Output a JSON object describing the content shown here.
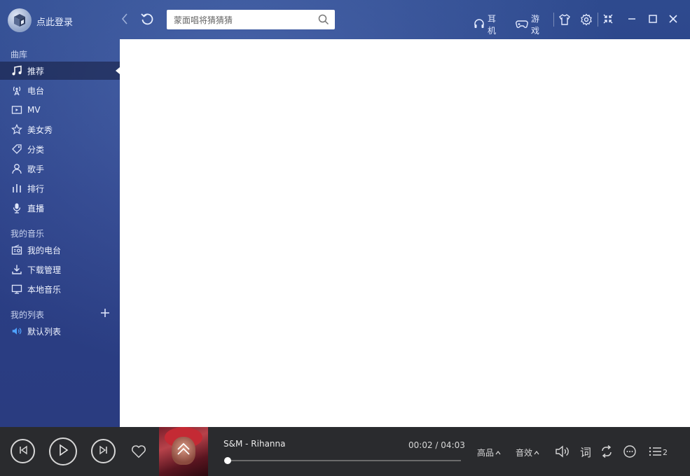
{
  "titlebar": {
    "login_text": "点此登录",
    "search_placeholder": "蒙面唱将猜猜猜",
    "headphone_label": "耳机",
    "game_label": "游戏"
  },
  "sidebar": {
    "library_title": "曲库",
    "library_items": [
      {
        "label": "推荐",
        "icon": "music-note-icon",
        "active": true
      },
      {
        "label": "电台",
        "icon": "radio-antenna-icon"
      },
      {
        "label": "MV",
        "icon": "video-icon"
      },
      {
        "label": "美女秀",
        "icon": "star-icon"
      },
      {
        "label": "分类",
        "icon": "tag-icon"
      },
      {
        "label": "歌手",
        "icon": "user-icon"
      },
      {
        "label": "排行",
        "icon": "bars-icon"
      },
      {
        "label": "直播",
        "icon": "microphone-icon"
      }
    ],
    "my_music_title": "我的音乐",
    "my_music_items": [
      {
        "label": "我的电台",
        "icon": "radio-icon"
      },
      {
        "label": "下载管理",
        "icon": "download-icon"
      },
      {
        "label": "本地音乐",
        "icon": "monitor-icon"
      }
    ],
    "my_list_title": "我的列表",
    "my_list_items": [
      {
        "label": "默认列表",
        "icon": "speaker-icon"
      }
    ]
  },
  "player": {
    "song": "S&M - Rihanna",
    "current_time": "00:02",
    "total_time": "04:03",
    "time_text": "00:02 / 04:03",
    "progress": 0.008,
    "quality_label": "高品",
    "effect_label": "音效",
    "lyrics_label": "词",
    "playlist_count": "2"
  },
  "colors": {
    "sidebar_bg": "#2b3f8a",
    "player_bg": "#2a2b2e",
    "accent_blue": "#4fa3ff"
  }
}
